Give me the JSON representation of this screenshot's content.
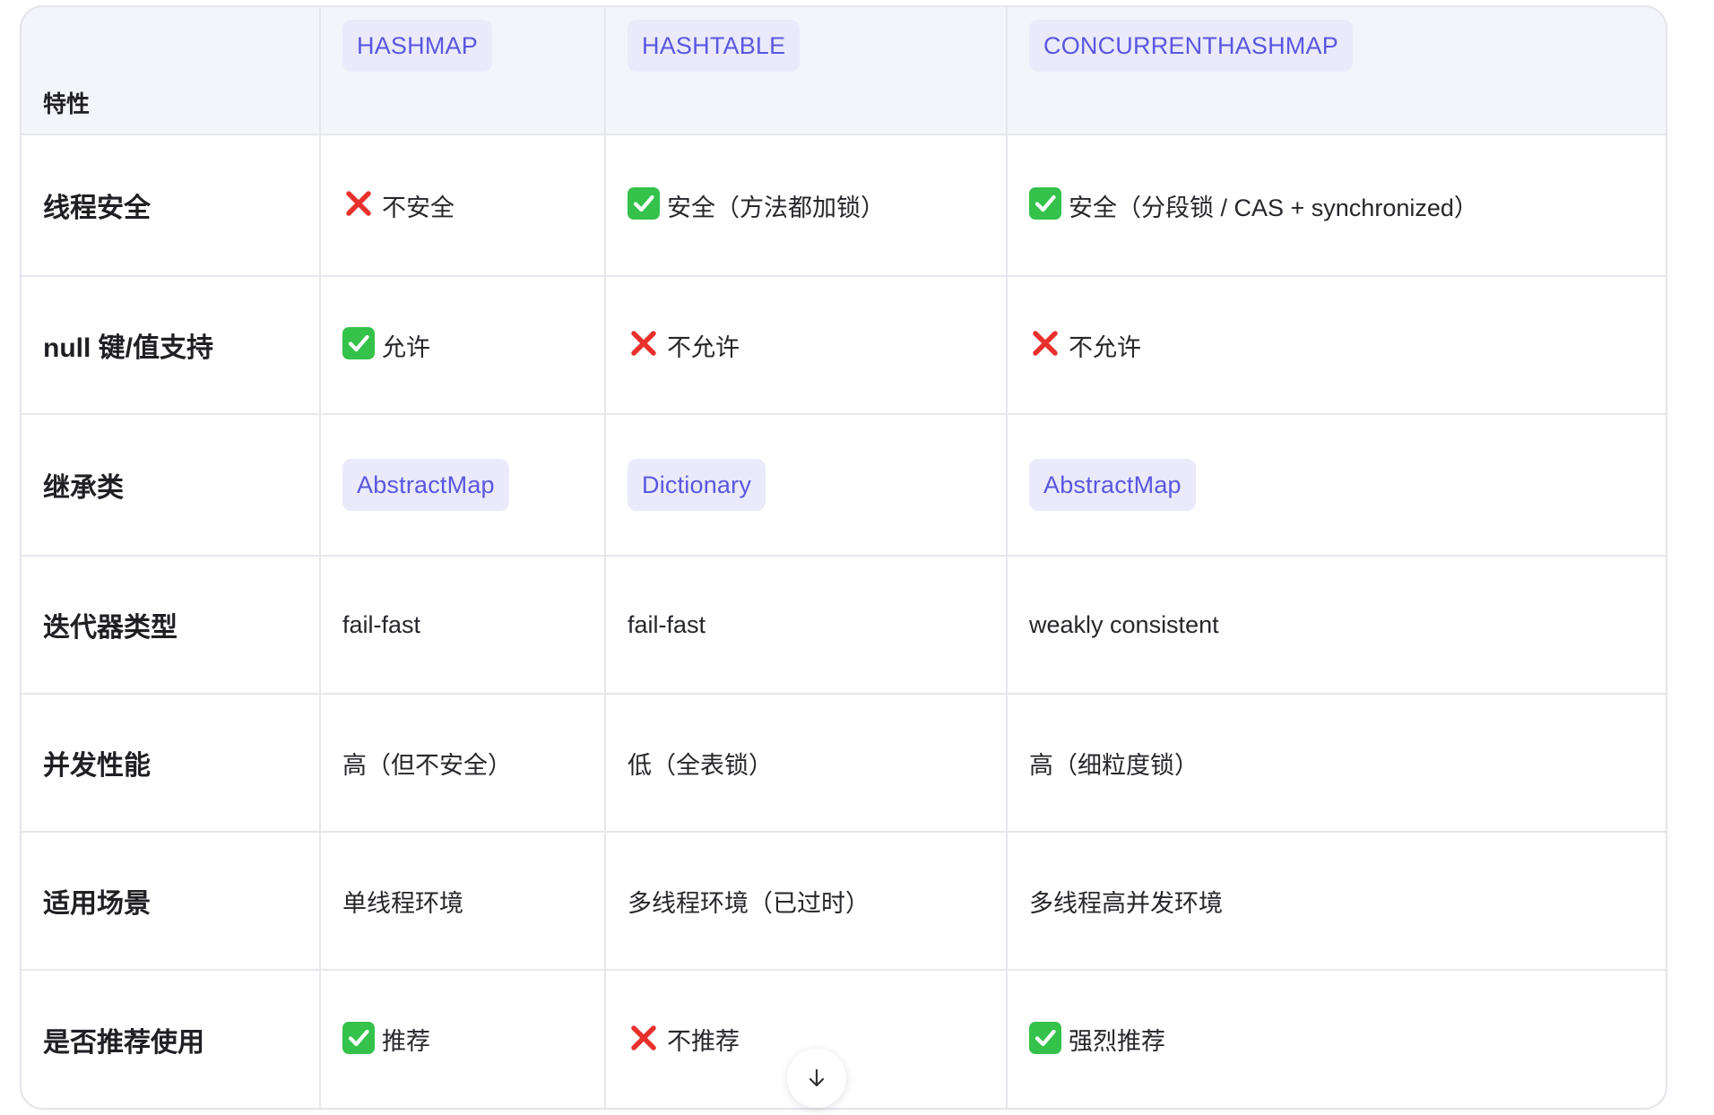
{
  "table": {
    "feature_header": "特性",
    "columns": [
      "HASHMAP",
      "HASHTABLE",
      "CONCURRENTHASHMAP"
    ],
    "rows": [
      {
        "label": "线程安全",
        "cells": [
          {
            "mark": "cross",
            "text": "不安全"
          },
          {
            "mark": "check",
            "text": "安全（方法都加锁）"
          },
          {
            "mark": "check",
            "text": "安全（分段锁 / CAS + synchronized）"
          }
        ]
      },
      {
        "label": "null 键/值支持",
        "cells": [
          {
            "mark": "check",
            "text": "允许"
          },
          {
            "mark": "cross",
            "text": "不允许"
          },
          {
            "mark": "cross",
            "text": "不允许"
          }
        ]
      },
      {
        "label": "继承类",
        "cells": [
          {
            "pill": true,
            "text": "AbstractMap"
          },
          {
            "pill": true,
            "text": "Dictionary"
          },
          {
            "pill": true,
            "text": "AbstractMap"
          }
        ]
      },
      {
        "label": "迭代器类型",
        "cells": [
          {
            "text": "fail-fast"
          },
          {
            "text": "fail-fast"
          },
          {
            "text": "weakly consistent"
          }
        ]
      },
      {
        "label": "并发性能",
        "cells": [
          {
            "text": "高（但不安全）"
          },
          {
            "text": "低（全表锁）"
          },
          {
            "text": "高（细粒度锁）"
          }
        ]
      },
      {
        "label": "适用场景",
        "cells": [
          {
            "text": "单线程环境"
          },
          {
            "text": "多线程环境（已过时）"
          },
          {
            "text": "多线程高并发环境"
          }
        ]
      },
      {
        "label": "是否推荐使用",
        "cells": [
          {
            "mark": "check",
            "text": "推荐"
          },
          {
            "mark": "cross",
            "text": "不推荐"
          },
          {
            "mark": "check",
            "text": "强烈推荐"
          }
        ]
      }
    ]
  },
  "icons": {
    "check": "check-mark-icon",
    "cross": "cross-mark-icon",
    "scroll": "arrow-down-icon"
  },
  "colors": {
    "header_bg": "#f4f5fa",
    "pill_bg": "#eaeafb",
    "pill_text": "#5b56e0",
    "check_green": "#34c24a",
    "cross_red": "#e8312c",
    "border": "#e6e7ec"
  }
}
